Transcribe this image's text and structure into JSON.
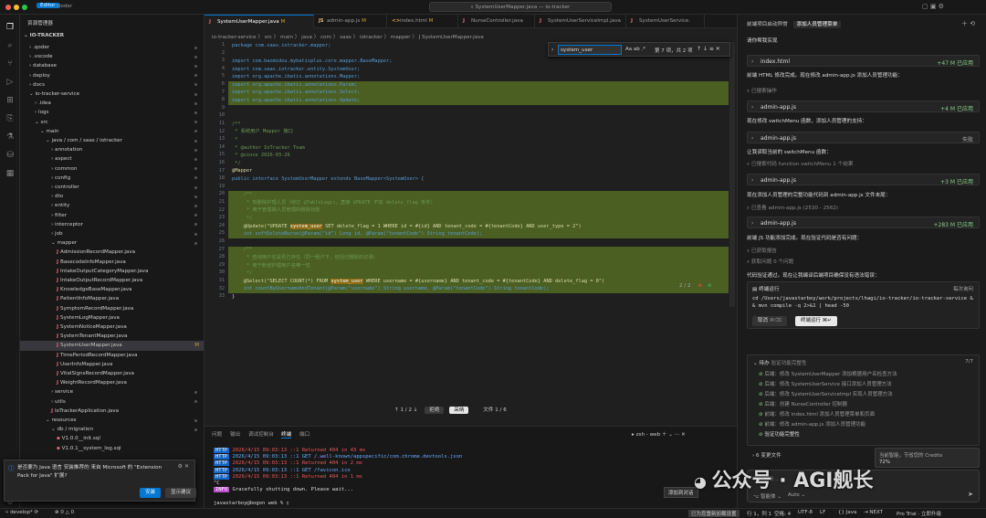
{
  "titlebar": {
    "app": "Editor",
    "mode": "Qoder",
    "search": "SystemUserMapper.java — io-tracker"
  },
  "explorer": {
    "header": "资源管理器",
    "root": "IO-TRACKER",
    "items": [
      {
        "label": ".qoder",
        "level": 1,
        "type": "folder"
      },
      {
        "label": ".vscode",
        "level": 1,
        "type": "folder"
      },
      {
        "label": "database",
        "level": 1,
        "type": "folder"
      },
      {
        "label": "deploy",
        "level": 1,
        "type": "folder"
      },
      {
        "label": "docs",
        "level": 1,
        "type": "folder"
      },
      {
        "label": "io-tracker-service",
        "level": 1,
        "type": "open"
      },
      {
        "label": ".idea",
        "level": 2,
        "type": "folder"
      },
      {
        "label": "logs",
        "level": 2,
        "type": "folder"
      },
      {
        "label": "src",
        "level": 2,
        "type": "open"
      },
      {
        "label": "main",
        "level": 3,
        "type": "open"
      },
      {
        "label": "java / com / saas / iotracker",
        "level": 4,
        "type": "open"
      },
      {
        "label": "annotation",
        "level": 5,
        "type": "folder"
      },
      {
        "label": "aspect",
        "level": 5,
        "type": "folder"
      },
      {
        "label": "common",
        "level": 5,
        "type": "folder"
      },
      {
        "label": "config",
        "level": 5,
        "type": "folder"
      },
      {
        "label": "controller",
        "level": 5,
        "type": "folder"
      },
      {
        "label": "dto",
        "level": 5,
        "type": "folder"
      },
      {
        "label": "entity",
        "level": 5,
        "type": "folder"
      },
      {
        "label": "filter",
        "level": 5,
        "type": "folder"
      },
      {
        "label": "interceptor",
        "level": 5,
        "type": "folder"
      },
      {
        "label": "job",
        "level": 5,
        "type": "folder"
      },
      {
        "label": "mapper",
        "level": 5,
        "type": "open"
      },
      {
        "label": "AdmissionRecordMapper.java",
        "level": 6,
        "type": "java"
      },
      {
        "label": "BasecodeInfoMapper.java",
        "level": 6,
        "type": "java"
      },
      {
        "label": "IntakeOutputCategoryMapper.java",
        "level": 6,
        "type": "java"
      },
      {
        "label": "IntakeOutputRecordMapper.java",
        "level": 6,
        "type": "java"
      },
      {
        "label": "KnowledgeBaseMapper.java",
        "level": 6,
        "type": "java"
      },
      {
        "label": "PatientInfoMapper.java",
        "level": 6,
        "type": "java"
      },
      {
        "label": "SymptomRecordMapper.java",
        "level": 6,
        "type": "java"
      },
      {
        "label": "SystemLogMapper.java",
        "level": 6,
        "type": "java"
      },
      {
        "label": "SystemNoticeMapper.java",
        "level": 6,
        "type": "java"
      },
      {
        "label": "SystemTenantMapper.java",
        "level": 6,
        "type": "java"
      },
      {
        "label": "SystemUserMapper.java",
        "level": 6,
        "type": "java",
        "selected": true,
        "mark": "M"
      },
      {
        "label": "TimePeriodRecordMapper.java",
        "level": 6,
        "type": "java"
      },
      {
        "label": "UserInfoMapper.java",
        "level": 6,
        "type": "java"
      },
      {
        "label": "VitalSignsRecordMapper.java",
        "level": 6,
        "type": "java"
      },
      {
        "label": "WeightRecordMapper.java",
        "level": 6,
        "type": "java"
      },
      {
        "label": "service",
        "level": 5,
        "type": "folder"
      },
      {
        "label": "utils",
        "level": 5,
        "type": "folder"
      },
      {
        "label": "IoTrackerApplication.java",
        "level": 5,
        "type": "java"
      },
      {
        "label": "resources",
        "level": 4,
        "type": "open"
      },
      {
        "label": "db / migration",
        "level": 5,
        "type": "open"
      },
      {
        "label": "V1.0.0__init.sql",
        "level": 6,
        "type": "sql"
      },
      {
        "label": "V1.0.1__system_log.sql",
        "level": 6,
        "type": "sql"
      }
    ]
  },
  "tabs": [
    {
      "label": "SystemUserMapper.java",
      "mark": "M",
      "icon": "J",
      "active": true
    },
    {
      "label": "admin-app.js",
      "mark": "M",
      "icon": "JS"
    },
    {
      "label": "index.html",
      "mark": "M",
      "icon": "<>"
    },
    {
      "label": "NurseController.java",
      "mark": "",
      "icon": "J"
    },
    {
      "label": "SystemUserServiceImpl.java",
      "mark": "",
      "icon": "J"
    },
    {
      "label": "SystemUserService.",
      "mark": "",
      "icon": "J"
    }
  ],
  "breadcrumb": "io-tracker-service 〉 src 〉 main 〉 java 〉 com 〉 saas 〉 iotracker 〉 mapper 〉 J SystemUserMapper.java",
  "find": {
    "value": "system_user",
    "opts": "Aa ab .*",
    "count": "第 7 项，共 2 项"
  },
  "code": [
    "package com.saas.iotracker.mapper;",
    "",
    "import com.baomidou.mybatisplus.core.mapper.BaseMapper;",
    "import com.saas.iotracker.entity.SystemUser;",
    "import org.apache.ibatis.annotations.Mapper;",
    "import org.apache.ibatis.annotations.Param;",
    "import org.apache.ibatis.annotations.Select;",
    "import org.apache.ibatis.annotations.Update;",
    "",
    "",
    "/**",
    " * 系统用户 Mapper 接口",
    " *",
    " * @author IoTracker Team",
    " * @since 2026-03-26",
    " */",
    "@Mapper",
    "public interface SystemUserMapper extends BaseMapper<SystemUser> {",
    "",
    "    /**",
    "     * 软删除护理人员（绕过 @TableLogic，直接 UPDATE 不加 delete_flag 条件）",
    "     * 用于管理端人员管理的删除功能",
    "     */",
    "    @Update(\"UPDATE system_user SET delete_flag = 1 WHERE id = #{id} AND tenant_code = #{tenantCode} AND user_type = 2\")",
    "    int softDeleteNurse(@Param(\"id\") Long id, @Param(\"tenantCode\") String tenantCode);",
    "",
    "    /**",
    "     * 查询用户名是否已存在（同一租户下，包括已删除的记录）",
    "     * 用于新增护理用户名唯一性",
    "     */",
    "    @Select(\"SELECT COUNT(*) FROM system_user WHERE username = #{username} AND tenant_code = #{tenantCode} AND delete_flag = 0\")",
    "    int countByUsernameAndTenant(@Param(\"username\") String username, @Param(\"tenantCode\") String tenantCode);",
    "}"
  ],
  "editor_footer": {
    "nav": "↑ 1 / 2 ↓",
    "reject": "拒绝",
    "accept": "采纳",
    "file": "文件 1 / 6",
    "page": "2 / 2"
  },
  "panel": {
    "tabs": [
      "问题",
      "输出",
      "调试控制台",
      "终端",
      "端口"
    ],
    "shell": "zsh - web",
    "lines": [
      {
        "badge": "HTTP",
        "text": "2026/4/15 09:03:13 ::1 Returned 404 in 43 ms"
      },
      {
        "badge": "HTTP",
        "text": "2026/4/15 09:03:13 ::1 GET /.well-known/appspecific/com.chrome.devtools.json"
      },
      {
        "badge": "HTTP",
        "text": "2026/4/15 09:03:13 ::1 Returned 404 in 2 ms"
      },
      {
        "badge": "HTTP",
        "text": "2026/4/15 09:03:13 ::1 GET /favicon.ico"
      },
      {
        "badge": "HTTP",
        "text": "2026/4/15 09:03:13 ::1 Returned 404 in 1 ms"
      },
      {
        "badge": "",
        "text": "^C"
      },
      {
        "badge": "INFO",
        "text": "Gracefully shutting down. Please wait..."
      },
      {
        "badge": "",
        "text": ""
      },
      {
        "badge": "",
        "text": "javastarboy@bogon web % ▯"
      }
    ],
    "add_chat": "添加到对话"
  },
  "chat": {
    "header_left": "前端项目启动异常",
    "header_tab": "添加人员管理菜单",
    "items": [
      {
        "t": "text",
        "v": "请你帮我实现"
      },
      {
        "t": "file",
        "v": "index.html",
        "stat": "+47  M  已应用"
      },
      {
        "t": "text",
        "v": "前端 HTML 修改完成。现在修改 admin-app.js 添加人员管理功能："
      },
      {
        "t": "sub",
        "v": "已搜索操作"
      },
      {
        "t": "file",
        "v": "admin-app.js",
        "stat": "+4  M  已应用"
      },
      {
        "t": "text",
        "v": "现在修改 switchMenu 函数，添加人员管理的支持："
      },
      {
        "t": "file",
        "v": "admin-app.js",
        "stat": "失败"
      },
      {
        "t": "text",
        "v": "让我读取当前的 switchMenu 函数："
      },
      {
        "t": "sub",
        "v": "已搜索代码  function switchMenu 1 个结果"
      },
      {
        "t": "file",
        "v": "admin-app.js",
        "stat": "+3  M  已应用"
      },
      {
        "t": "text",
        "v": "现在添加人员管理的完整功能代码到 admin-app.js 文件末尾："
      },
      {
        "t": "sub",
        "v": "已查看 admin-app.js (2530 - 2562)"
      },
      {
        "t": "file",
        "v": "admin-app.js",
        "stat": "+283  M  已应用"
      },
      {
        "t": "text",
        "v": "前端 JS 功能添加完成。现在验证代码是否有问题："
      },
      {
        "t": "sub",
        "v": "已获取报告"
      },
      {
        "t": "sub",
        "v": "获取问题  0 个问题"
      },
      {
        "t": "text",
        "v": "代码验证通过。现在让我编译后端项目确保没有语法错误："
      }
    ],
    "term": {
      "title": "终端运行",
      "mode": "每次询问",
      "cmd": "cd /Users/javastarboy/work/projects/lhagi/io-tracker/io-tracker-service && mvn compile -q 2>&1 | head -50",
      "cancel": "取消",
      "cancel_key": "⌘⌫",
      "run": "终端运行",
      "run_key": "⌘↵"
    },
    "todo": {
      "title": "待办",
      "subtitle": "验证功能完整性",
      "count": "7/7",
      "items": [
        "后端：修改 SystemUserMapper 添加根据用户名检查方法",
        "后端：修改 SystemUserService 接口添加人员管理方法",
        "后端：修改 SystemUserServiceImpl 实现人员管理方法",
        "后端：创建 NurseController 控制器",
        "前端：修改 index.html 添加人员管理菜单和页面",
        "前端：修改 admin-app.js 添加人员管理功能",
        "验证功能完整性"
      ]
    },
    "changes": "6 变更文件",
    "credits": "当前智能，节省您的 Credits",
    "credits_pct": "72%",
    "input_hint": "输入编辑 ...",
    "model": "智能体",
    "auto": "Auto"
  },
  "notify": {
    "text": "是否要为 Java 语言 安装推荐的 来自 Microsoft 的 \"Extension Pack for Java\" 扩展?",
    "install": "安装",
    "show": "显示建议"
  },
  "status": {
    "branch": "develop*",
    "errors": "⊗ 0 △ 0",
    "right": [
      "已为您重新加载设置",
      "行 1，列 1",
      "空格: 4",
      "UTF-8",
      "LF",
      "{} Java",
      "⇥ NEXT",
      "Pro Trial · 立即升级"
    ]
  },
  "watermark": "公众号 · AGI舰长"
}
